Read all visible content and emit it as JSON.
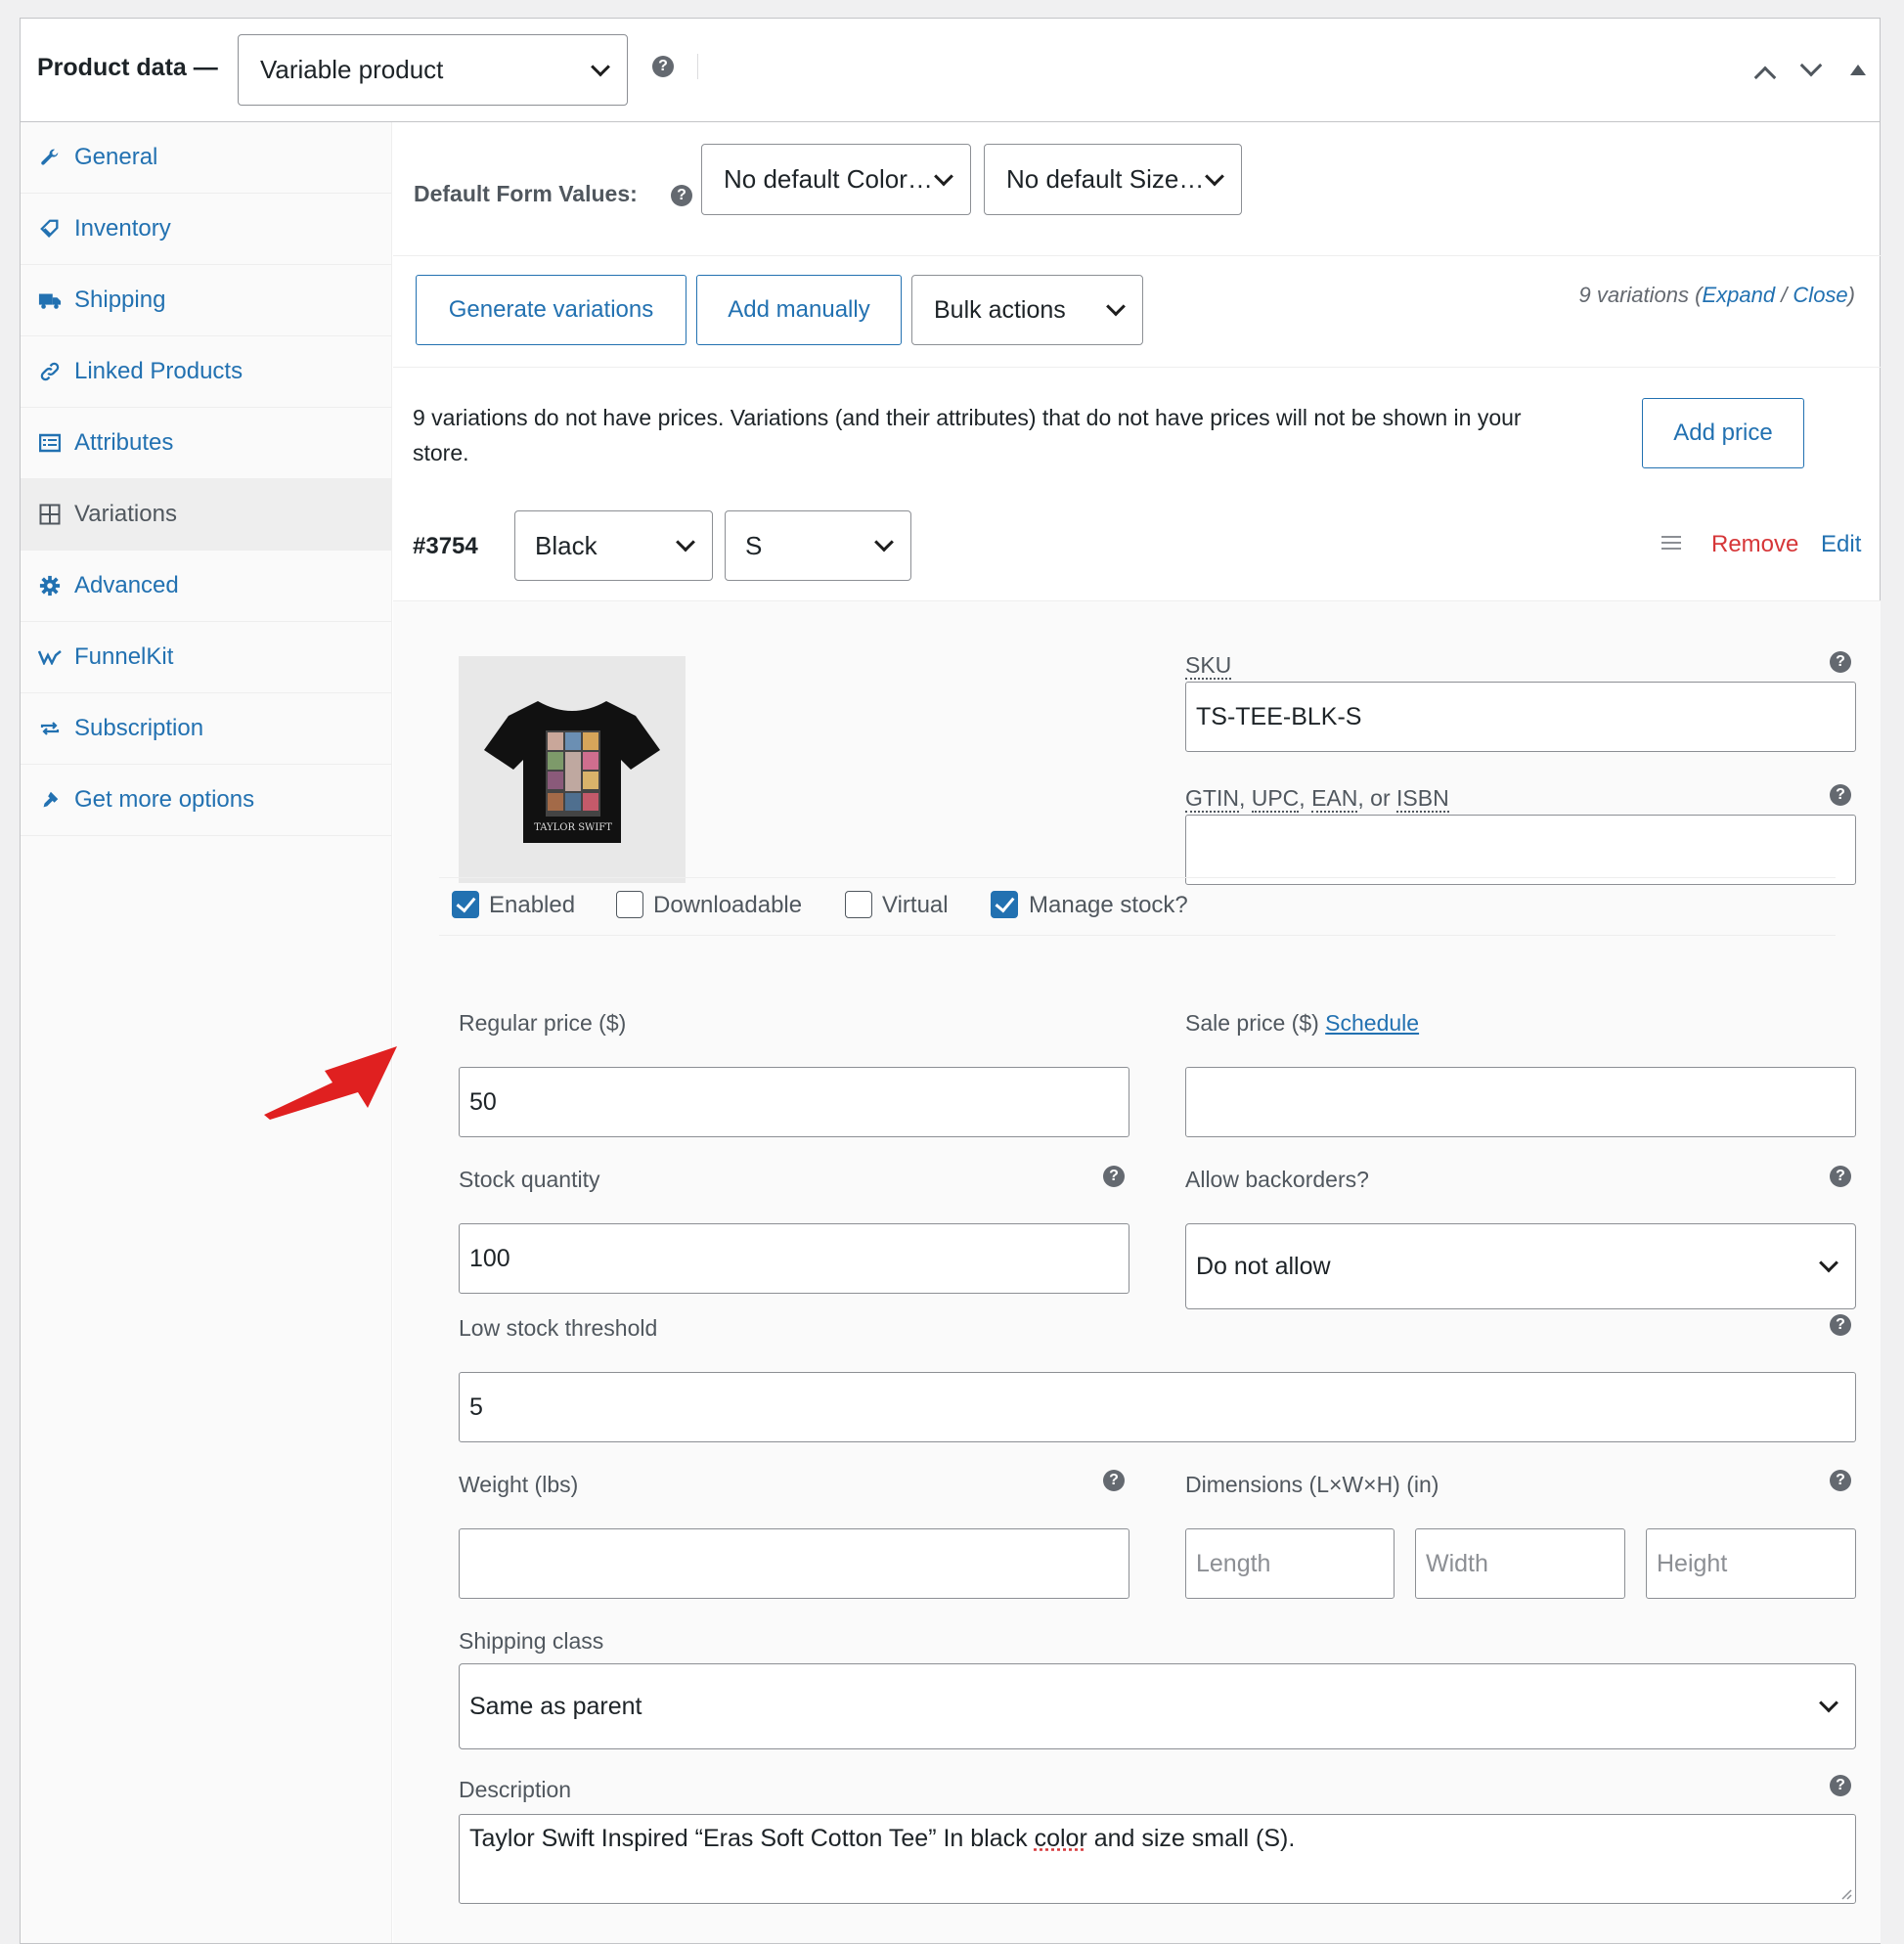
{
  "header": {
    "title": "Product data —",
    "product_type": "Variable product"
  },
  "sidebar": {
    "items": [
      {
        "label": "General",
        "icon": "wrench-icon"
      },
      {
        "label": "Inventory",
        "icon": "tag-icon"
      },
      {
        "label": "Shipping",
        "icon": "truck-icon"
      },
      {
        "label": "Linked Products",
        "icon": "link-icon"
      },
      {
        "label": "Attributes",
        "icon": "list-icon"
      },
      {
        "label": "Variations",
        "icon": "grid-icon"
      },
      {
        "label": "Advanced",
        "icon": "gear-icon"
      },
      {
        "label": "FunnelKit",
        "icon": "funnelkit-icon"
      },
      {
        "label": "Subscription",
        "icon": "repeat-icon"
      },
      {
        "label": "Get more options",
        "icon": "plugin-icon"
      }
    ],
    "active": "Variations"
  },
  "default_form_values": {
    "label": "Default Form Values:",
    "color_select": "No default Color…",
    "size_select": "No default Size…"
  },
  "toolbar": {
    "generate_label": "Generate variations",
    "add_manually_label": "Add manually",
    "bulk_actions_label": "Bulk actions",
    "variation_count": "9 variations (",
    "expand": "Expand",
    "slash": " / ",
    "close": "Close",
    "close_paren": ")"
  },
  "notice": {
    "text": "9 variations do not have prices. Variations (and their attributes) that do not have prices will not be shown in your store.",
    "button": "Add price"
  },
  "variation": {
    "id": "#3754",
    "color": "Black",
    "size": "S",
    "remove": "Remove",
    "edit": "Edit",
    "sku_label": "SKU",
    "sku": "TS-TEE-BLK-S",
    "gtin_label_parts": [
      "GTIN",
      ", ",
      "UPC",
      ", ",
      "EAN",
      ", or ",
      "ISBN"
    ],
    "gtin": "",
    "checkboxes": {
      "enabled": "Enabled",
      "downloadable": "Downloadable",
      "virtual": "Virtual",
      "manage_stock": "Manage stock?"
    },
    "regular_price_label": "Regular price ($)",
    "regular_price": "50",
    "sale_price_label": "Sale price ($)",
    "schedule": "Schedule",
    "sale_price": "",
    "stock_qty_label": "Stock quantity",
    "stock_qty": "100",
    "backorders_label": "Allow backorders?",
    "backorders": "Do not allow",
    "low_stock_label": "Low stock threshold",
    "low_stock": "5",
    "weight_label": "Weight (lbs)",
    "weight": "",
    "dimensions_label": "Dimensions (L×W×H) (in)",
    "length_ph": "Length",
    "width_ph": "Width",
    "height_ph": "Height",
    "shipping_class_label": "Shipping class",
    "shipping_class": "Same as parent",
    "description_label": "Description",
    "description_before": "Taylor Swift Inspired “Eras Soft Cotton Tee” In black ",
    "description_spell": "color",
    "description_after": " and size small (S).",
    "thumbnail_caption": "TAYLOR SWIFT"
  },
  "colors": {
    "link": "#2271b1",
    "remove": "#d63638",
    "annotation_arrow": "#e02020"
  }
}
